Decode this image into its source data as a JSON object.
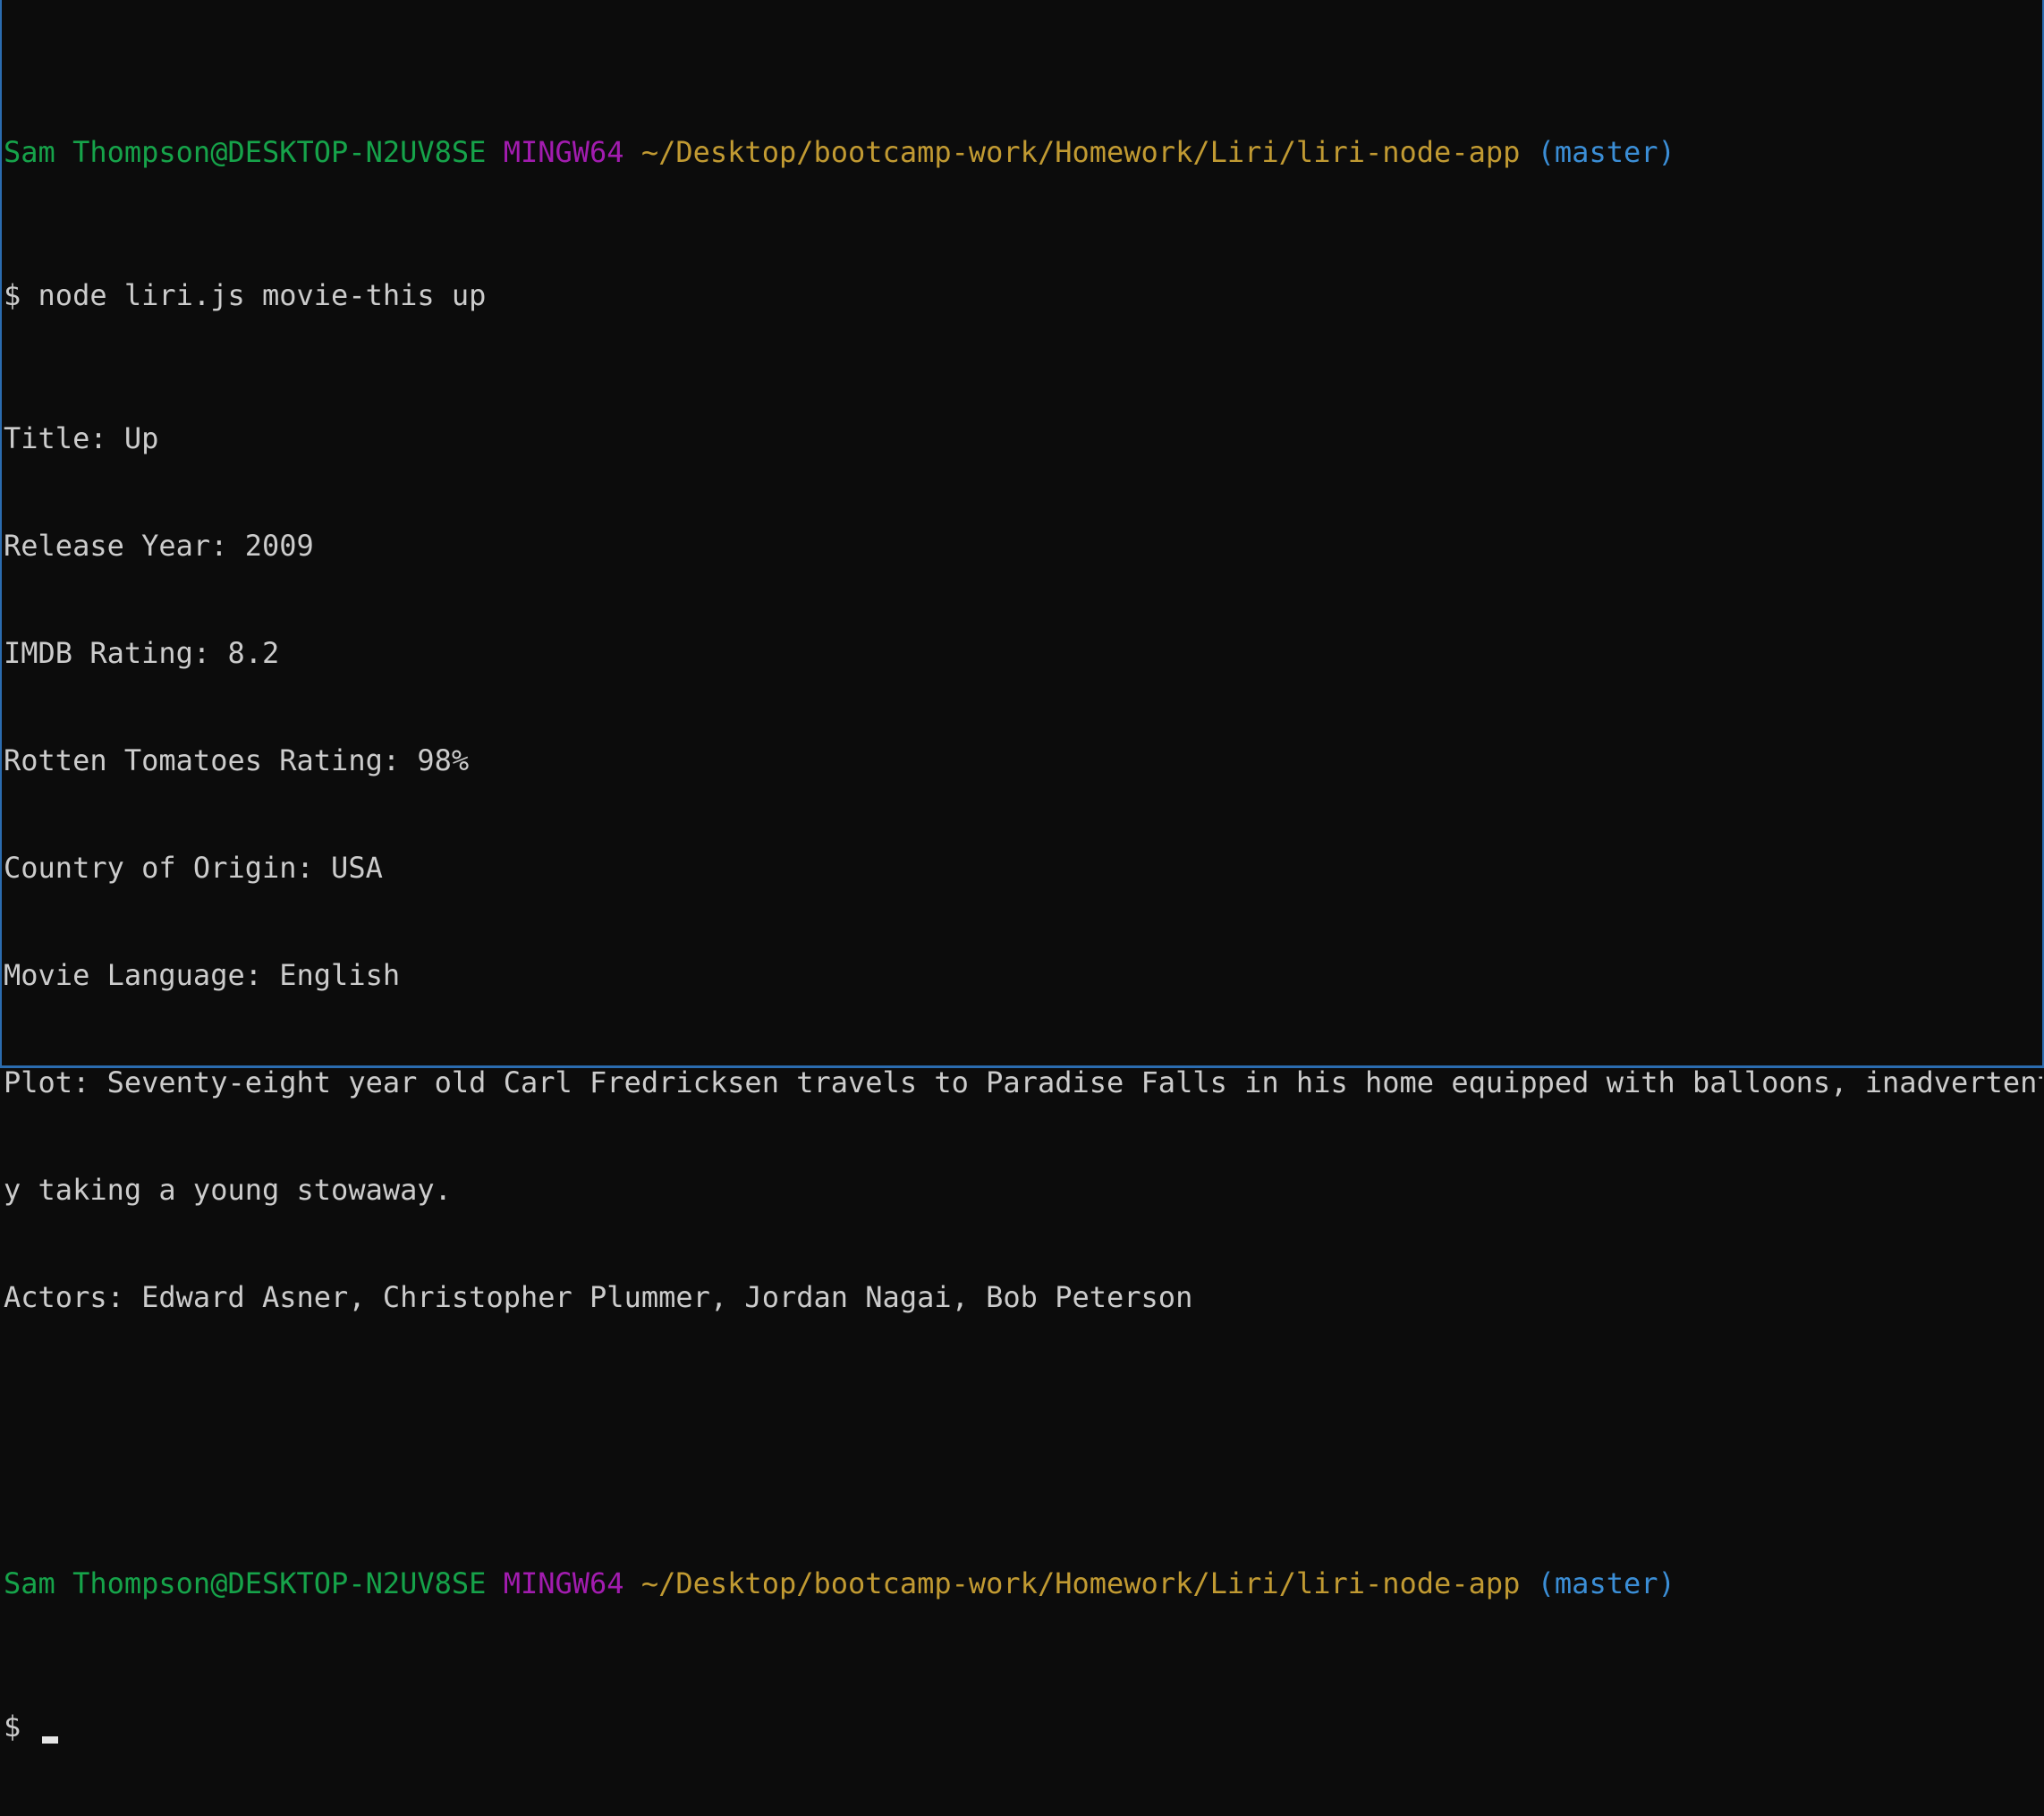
{
  "prompt": {
    "user_host": "Sam Thompson@DESKTOP-N2UV8SE",
    "system": "MINGW64",
    "path": "~/Desktop/bootcamp-work/Homework/Liri/liri-node-app",
    "branch": "(master)",
    "symbol": "$"
  },
  "command": "node liri.js movie-this up",
  "output": [
    "Title: Up",
    "Release Year: 2009",
    "IMDB Rating: 8.2",
    "Rotten Tomatoes Rating: 98%",
    "Country of Origin: USA",
    "Movie Language: English",
    "Plot: Seventy-eight year old Carl Fredricksen travels to Paradise Falls in his home equipped with balloons, inadvertentl",
    "y taking a young stowaway.",
    "Actors: Edward Asner, Christopher Plummer, Jordan Nagai, Bob Peterson"
  ],
  "colors": {
    "background": "#0c0c0c",
    "text": "#cccccc",
    "user_host": "#16a34a",
    "system": "#a21caf",
    "path": "#c19a32",
    "branch": "#3b8ed6",
    "window_border": "#2b6cb0"
  }
}
